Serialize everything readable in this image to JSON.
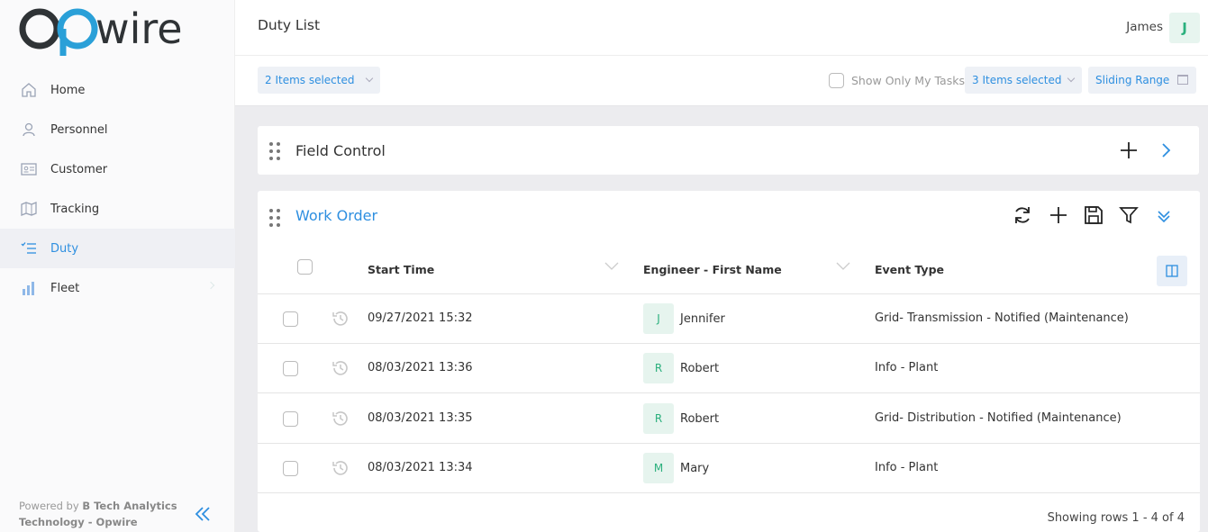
{
  "brand": {
    "name": "opwire",
    "accent": "#2e8fe0",
    "logo_dark": "#2f3336",
    "logo_blue": "#2aa0d8"
  },
  "sidebar": {
    "items": [
      {
        "label": "Home",
        "icon": "home-icon",
        "active": false
      },
      {
        "label": "Personnel",
        "icon": "person-icon",
        "active": false
      },
      {
        "label": "Customer",
        "icon": "id-card-icon",
        "active": false
      },
      {
        "label": "Tracking",
        "icon": "map-icon",
        "active": false
      },
      {
        "label": "Duty",
        "icon": "checklist-icon",
        "active": true
      },
      {
        "label": "Fleet",
        "icon": "bar-chart-icon",
        "active": false
      }
    ],
    "powered_prefix": "Powered by ",
    "powered_company": "B Tech Analytics Technology - Opwire"
  },
  "header": {
    "title": "Duty List",
    "user_name": "James",
    "user_initial": "J"
  },
  "filters": {
    "left_select": "2 Items selected",
    "show_only_my_tasks": "Show Only My Tasks",
    "right_select": "3 Items selected",
    "range_select": "Sliding Range"
  },
  "panels": {
    "field_control": {
      "title": "Field Control"
    },
    "work_order": {
      "title": "Work Order"
    }
  },
  "table": {
    "columns": [
      "Start Time",
      "Engineer - First Name",
      "Event Type"
    ],
    "rows": [
      {
        "start_time": "09/27/2021 15:32",
        "engineer_initial": "J",
        "engineer": "Jennifer",
        "event_type": "Grid- Transmission - Notified (Maintenance)"
      },
      {
        "start_time": "08/03/2021 13:36",
        "engineer_initial": "R",
        "engineer": "Robert",
        "event_type": "Info - Plant"
      },
      {
        "start_time": "08/03/2021 13:35",
        "engineer_initial": "R",
        "engineer": "Robert",
        "event_type": "Grid- Distribution - Notified (Maintenance)"
      },
      {
        "start_time": "08/03/2021 13:34",
        "engineer_initial": "M",
        "engineer": "Mary",
        "event_type": "Info - Plant"
      }
    ],
    "footer": "Showing rows 1 - 4 of 4"
  }
}
